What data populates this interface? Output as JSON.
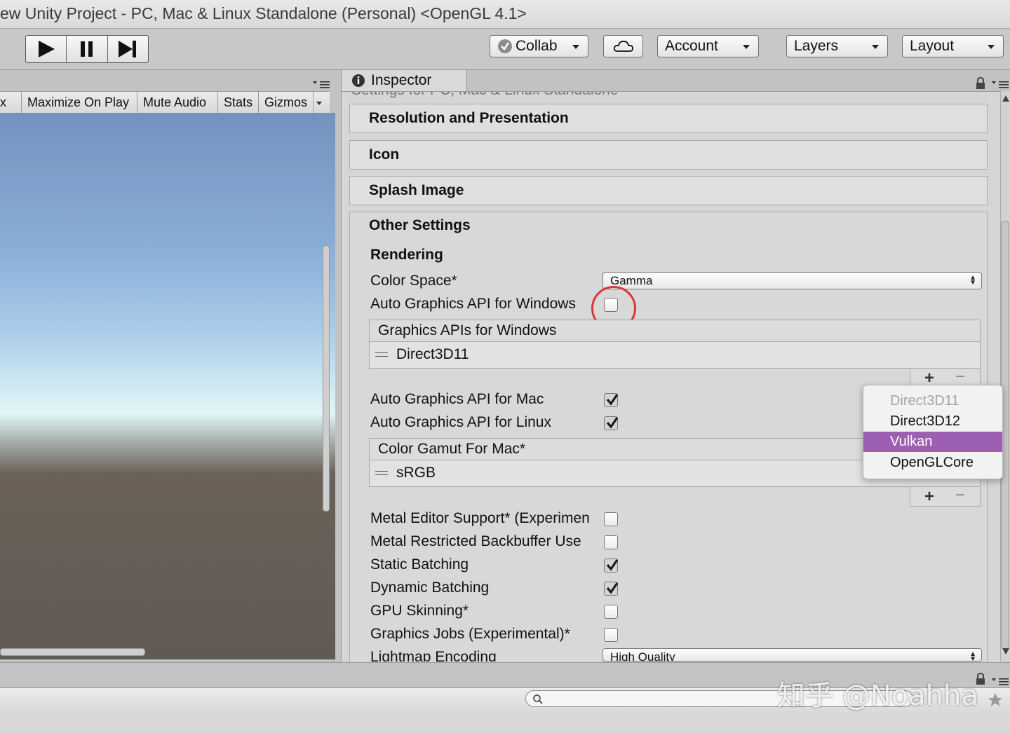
{
  "window": {
    "title": "ew Unity Project - PC, Mac & Linux Standalone (Personal) <OpenGL 4.1>"
  },
  "toolbar": {
    "collab_label": "Collab",
    "account_label": "Account",
    "layers_label": "Layers",
    "layout_label": "Layout"
  },
  "game_view": {
    "partial_label": "x",
    "options": [
      "Maximize On Play",
      "Mute Audio",
      "Stats",
      "Gizmos"
    ]
  },
  "inspector": {
    "tab_label": "Inspector",
    "cut_off_header": "Settings for PC, Mac & Linux Standalone",
    "sections": {
      "resolution": "Resolution and Presentation",
      "icon": "Icon",
      "splash": "Splash Image",
      "other": "Other Settings"
    },
    "rendering_label": "Rendering",
    "color_space": {
      "label": "Color Space*",
      "value": "Gamma"
    },
    "auto_api_windows": {
      "label": "Auto Graphics API for Windows",
      "checked": false
    },
    "graphics_apis_windows": {
      "header": "Graphics APIs for Windows",
      "items": [
        "Direct3D11"
      ]
    },
    "auto_api_mac": {
      "label": "Auto Graphics API for Mac",
      "checked": true
    },
    "auto_api_linux": {
      "label": "Auto Graphics API for Linux",
      "checked": true
    },
    "color_gamut_mac": {
      "header": "Color Gamut For Mac*",
      "items": [
        "sRGB"
      ]
    },
    "metal_editor_support": {
      "label": "Metal Editor Support* (Experimen",
      "checked": false
    },
    "metal_restricted_backbuffer": {
      "label": "Metal Restricted Backbuffer Use",
      "checked": false
    },
    "static_batching": {
      "label": "Static Batching",
      "checked": true
    },
    "dynamic_batching": {
      "label": "Dynamic Batching",
      "checked": true
    },
    "gpu_skinning": {
      "label": "GPU Skinning*",
      "checked": false
    },
    "graphics_jobs": {
      "label": "Graphics Jobs (Experimental)*",
      "checked": false
    },
    "lightmap_encoding": {
      "label": "Lightmap Encoding",
      "value": "High Quality"
    }
  },
  "api_dropdown": {
    "items": [
      {
        "label": "Direct3D11",
        "state": "disabled"
      },
      {
        "label": "Direct3D12",
        "state": "normal"
      },
      {
        "label": "Vulkan",
        "state": "selected"
      },
      {
        "label": "OpenGLCore",
        "state": "normal"
      }
    ]
  },
  "watermark": "知乎 @Noahha",
  "colors": {
    "highlight_circle": "#d9363b",
    "dropdown_selected": "#9c5fb1"
  }
}
